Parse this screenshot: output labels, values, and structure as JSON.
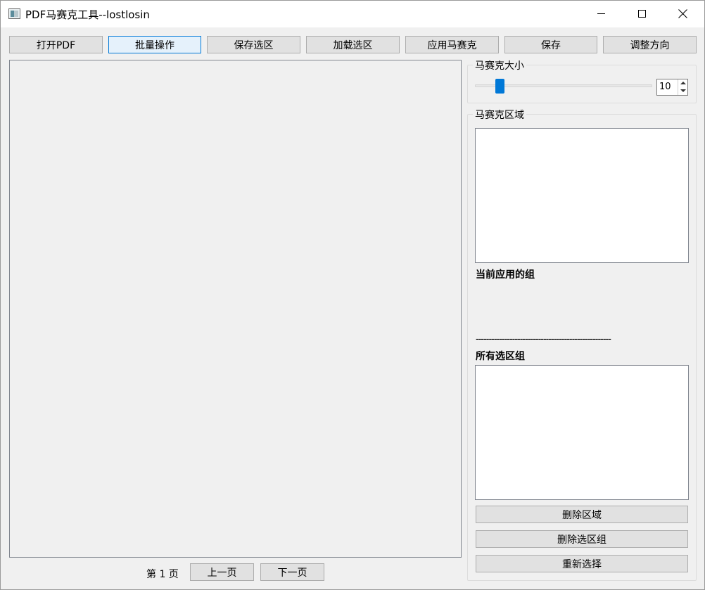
{
  "window": {
    "title": "PDF马赛克工具--lostlosin",
    "controls": [
      "minimize-icon",
      "maximize-icon",
      "close-icon"
    ]
  },
  "toolbar": {
    "open_pdf": "打开PDF",
    "batch": "批量操作",
    "save_selection": "保存选区",
    "load_selection": "加载选区",
    "apply_mosaic": "应用马赛克",
    "save": "保存",
    "adjust_orientation": "调整方向"
  },
  "mosaic_size": {
    "title": "马赛克大小",
    "value": "10",
    "slider_fraction": 0.12
  },
  "mosaic_region": {
    "title": "马赛克区域",
    "current_group_label": "当前应用的组",
    "separator": "----------------------------------------------------",
    "all_groups_label": "所有选区组",
    "delete_region": "删除区域",
    "delete_group": "删除选区组",
    "reselect": "重新选择"
  },
  "pager": {
    "page_text": "第 1 页",
    "prev": "上一页",
    "next": "下一页"
  },
  "colors": {
    "accent": "#0078d7",
    "background": "#f0f0f0",
    "button": "#e1e1e1"
  }
}
